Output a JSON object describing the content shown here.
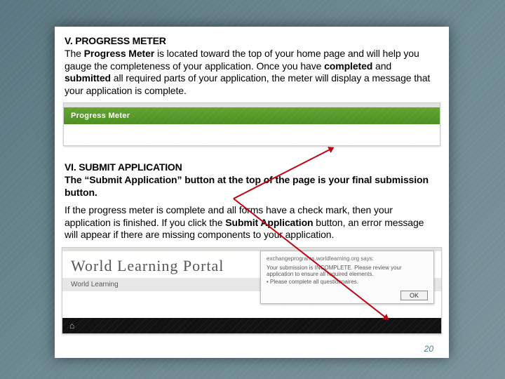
{
  "sectionV": {
    "heading": "V. PROGRESS METER",
    "para_prefix": "The ",
    "para_bold1": "Progress Meter",
    "para_mid1": " is located toward the top of your home page and will help you gauge the completeness of your application. Once you have ",
    "para_bold2": "completed",
    "para_mid2": " and ",
    "para_bold3": "submitted",
    "para_end": " all required parts of your application, the meter will display a message that your application is complete."
  },
  "pm_label": "Progress Meter",
  "sectionVI": {
    "heading": "VI. SUBMIT APPLICATION",
    "lead_bold": "The “Submit Application” button at the top of the page is your final submission button.",
    "para2_a": "If the progress meter is complete and all forms have a check mark, then your application is finished. If you click the ",
    "para2_bold": "Submit Application",
    "para2_b": " button, an error message will appear if there are missing components to your application."
  },
  "portal": {
    "logo": "World Learning Portal",
    "tab": "World Learning",
    "dialog_source": "exchangeprograms.worldlearning.org says:",
    "dialog_line1": "Your submission is INCOMPLETE. Please review your application to ensure all required elements.",
    "dialog_line2": "• Please complete all questionnaires.",
    "dialog_ok": "OK"
  },
  "page_number": "20"
}
